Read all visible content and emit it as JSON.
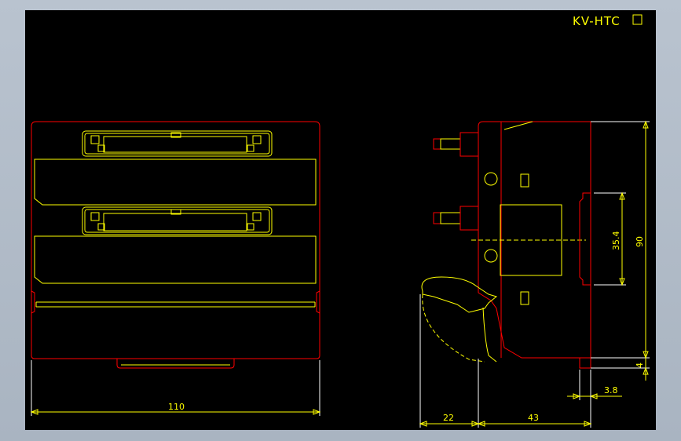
{
  "title": "KV-HTC",
  "title_box_glyph": "□",
  "dimensions": {
    "width_front": "110",
    "height": "90",
    "slot_height": "35.4",
    "bottom_gap": "4",
    "foot_width": "3.8",
    "left_depth": "22",
    "right_depth": "43"
  },
  "colors": {
    "background": "#000000",
    "outline": "#ff0000",
    "detail": "#ffff00",
    "frame": "#a9b4c1"
  }
}
